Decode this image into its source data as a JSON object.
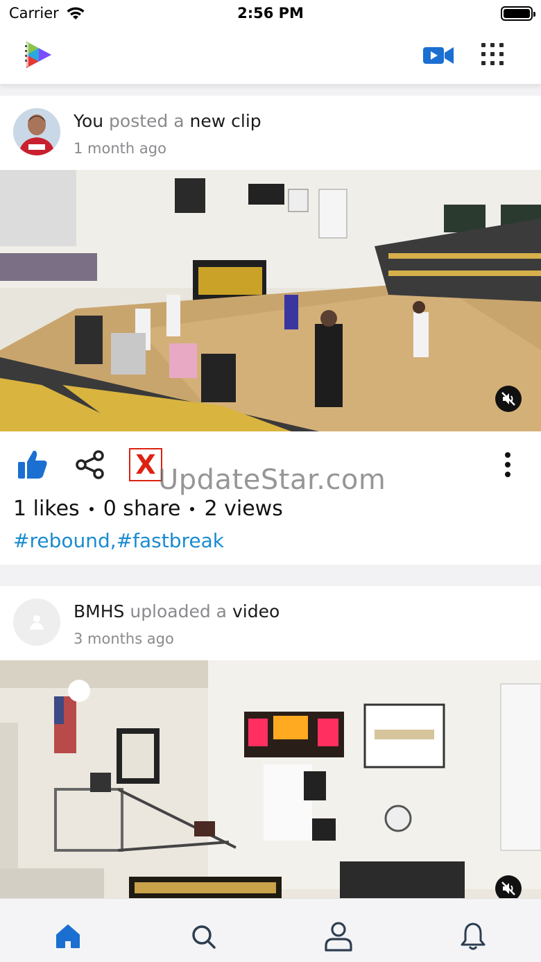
{
  "status_bar": {
    "carrier": "Carrier",
    "time": "2:56 PM"
  },
  "header": {
    "logo_icon": "play-logo-icon",
    "video_icon": "video-camera-icon",
    "menu_icon": "grid-menu-icon",
    "accent": "#1a6fd1"
  },
  "posts": [
    {
      "actor": "You",
      "verb": "posted a",
      "object": "new clip",
      "time": "1 month ago",
      "media_icon": "mute-icon",
      "likes": "1 likes",
      "shares": "0 share",
      "views": "2 views",
      "hashtags": "#rebound,#fastbreak"
    },
    {
      "actor": "BMHS",
      "verb": "uploaded a",
      "object": "video",
      "time": "3 months ago",
      "media_icon": "mute-icon"
    }
  ],
  "watermark": "UpdateStar.com",
  "colors": {
    "hashtag": "#1b8bd0",
    "like": "#1a6fd1",
    "muted_text": "#8a8a8e"
  },
  "bottom_nav": [
    {
      "icon": "home-icon",
      "active": true
    },
    {
      "icon": "search-icon",
      "active": false
    },
    {
      "icon": "profile-icon",
      "active": false
    },
    {
      "icon": "bell-icon",
      "active": false
    }
  ]
}
